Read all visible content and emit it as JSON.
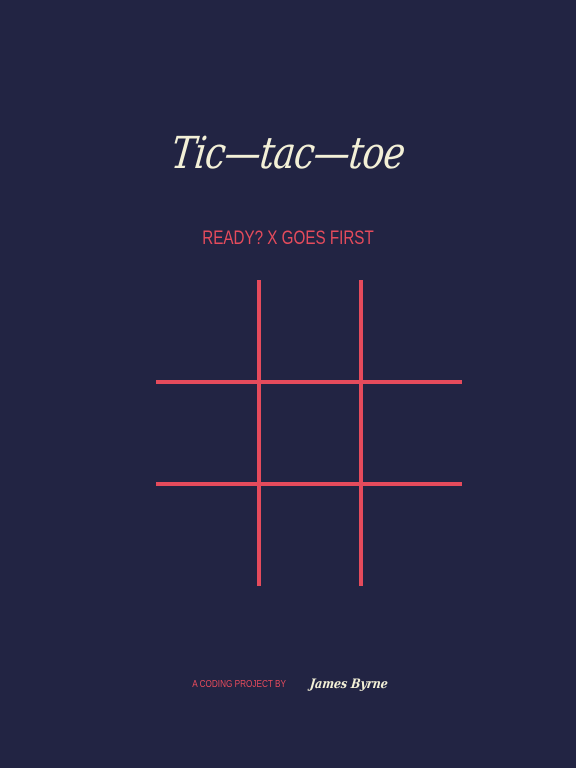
{
  "game": {
    "title": "Tic—tac—toe",
    "status": "READY? X GOES FIRST",
    "board": {
      "cells": [
        "",
        "",
        "",
        "",
        "",
        "",
        "",
        "",
        ""
      ]
    }
  },
  "footer": {
    "label": "A CODING PROJECT BY",
    "author": "James Byrne"
  },
  "colors": {
    "background": "#222443",
    "accent": "#e54b5c",
    "title": "#f3f0d7"
  }
}
